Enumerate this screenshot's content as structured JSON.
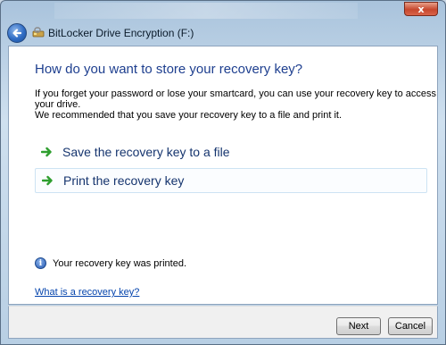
{
  "window": {
    "title": "BitLocker Drive Encryption (F:)",
    "close_label": "x"
  },
  "main": {
    "heading": "How do you want to store your recovery key?",
    "para1": "If you forget your password or lose your smartcard, you can use your recovery key to access your drive.",
    "para2": "We recommended that you save your recovery key to a file and print it.",
    "options": [
      {
        "label": "Save the recovery key to a file",
        "icon": "green-arrow-icon"
      },
      {
        "label": "Print the recovery key",
        "icon": "green-arrow-icon"
      }
    ],
    "info_message": "Your recovery key was printed.",
    "help_link": "What is a recovery key?"
  },
  "footer": {
    "next_label": "Next",
    "cancel_label": "Cancel"
  },
  "colors": {
    "heading": "#1e3f8f",
    "link": "#0645ad",
    "arrow": "#2e9e2e"
  }
}
